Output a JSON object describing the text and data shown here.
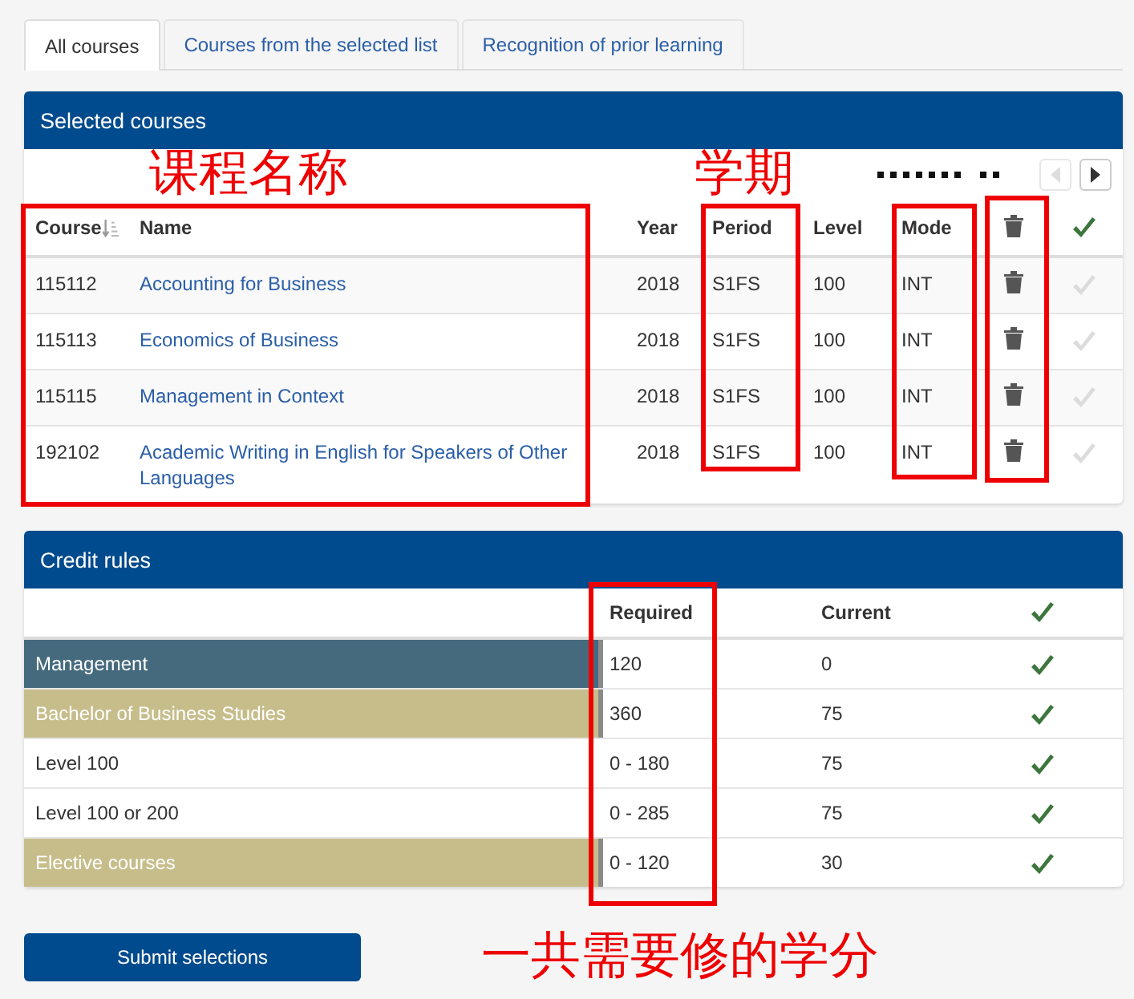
{
  "tabs": [
    {
      "label": "All courses",
      "selected": true
    },
    {
      "label": "Courses from the selected list",
      "selected": false
    },
    {
      "label": "Recognition of prior learning",
      "selected": false
    }
  ],
  "selected_courses": {
    "title": "Selected courses",
    "pager": {
      "prev_disabled": true,
      "next_disabled": false
    },
    "columns": [
      "Course",
      "Name",
      "Year",
      "Period",
      "Level",
      "Mode"
    ],
    "rows": [
      {
        "course": "115112",
        "name": "Accounting for Business",
        "year": "2018",
        "period": "S1FS",
        "level": "100",
        "mode": "INT",
        "confirmed": false
      },
      {
        "course": "115113",
        "name": "Economics of Business",
        "year": "2018",
        "period": "S1FS",
        "level": "100",
        "mode": "INT",
        "confirmed": false
      },
      {
        "course": "115115",
        "name": "Management in Context",
        "year": "2018",
        "period": "S1FS",
        "level": "100",
        "mode": "INT",
        "confirmed": false
      },
      {
        "course": "192102",
        "name": "Academic Writing in English for Speakers of Other Languages",
        "year": "2018",
        "period": "S1FS",
        "level": "100",
        "mode": "INT",
        "confirmed": false
      }
    ]
  },
  "credit_rules": {
    "title": "Credit rules",
    "columns": [
      "Required",
      "Current"
    ],
    "rows": [
      {
        "rule": "Management",
        "required": "120",
        "current": "0",
        "met": true,
        "color": "#456a7e"
      },
      {
        "rule": "Bachelor of Business Studies",
        "required": "360",
        "current": "75",
        "met": true,
        "color": "#c6bd8b"
      },
      {
        "rule": "Level 100",
        "required": "0 - 180",
        "current": "75",
        "met": true
      },
      {
        "rule": "Level 100 or 200",
        "required": "0 - 285",
        "current": "75",
        "met": true
      },
      {
        "rule": "Elective courses",
        "required": "0 - 120",
        "current": "30",
        "met": true,
        "color": "#c6bd8b"
      }
    ]
  },
  "submit_button": "Submit selections",
  "annotations": [
    "课程名称",
    "学期",
    "一共需要修的学分"
  ]
}
